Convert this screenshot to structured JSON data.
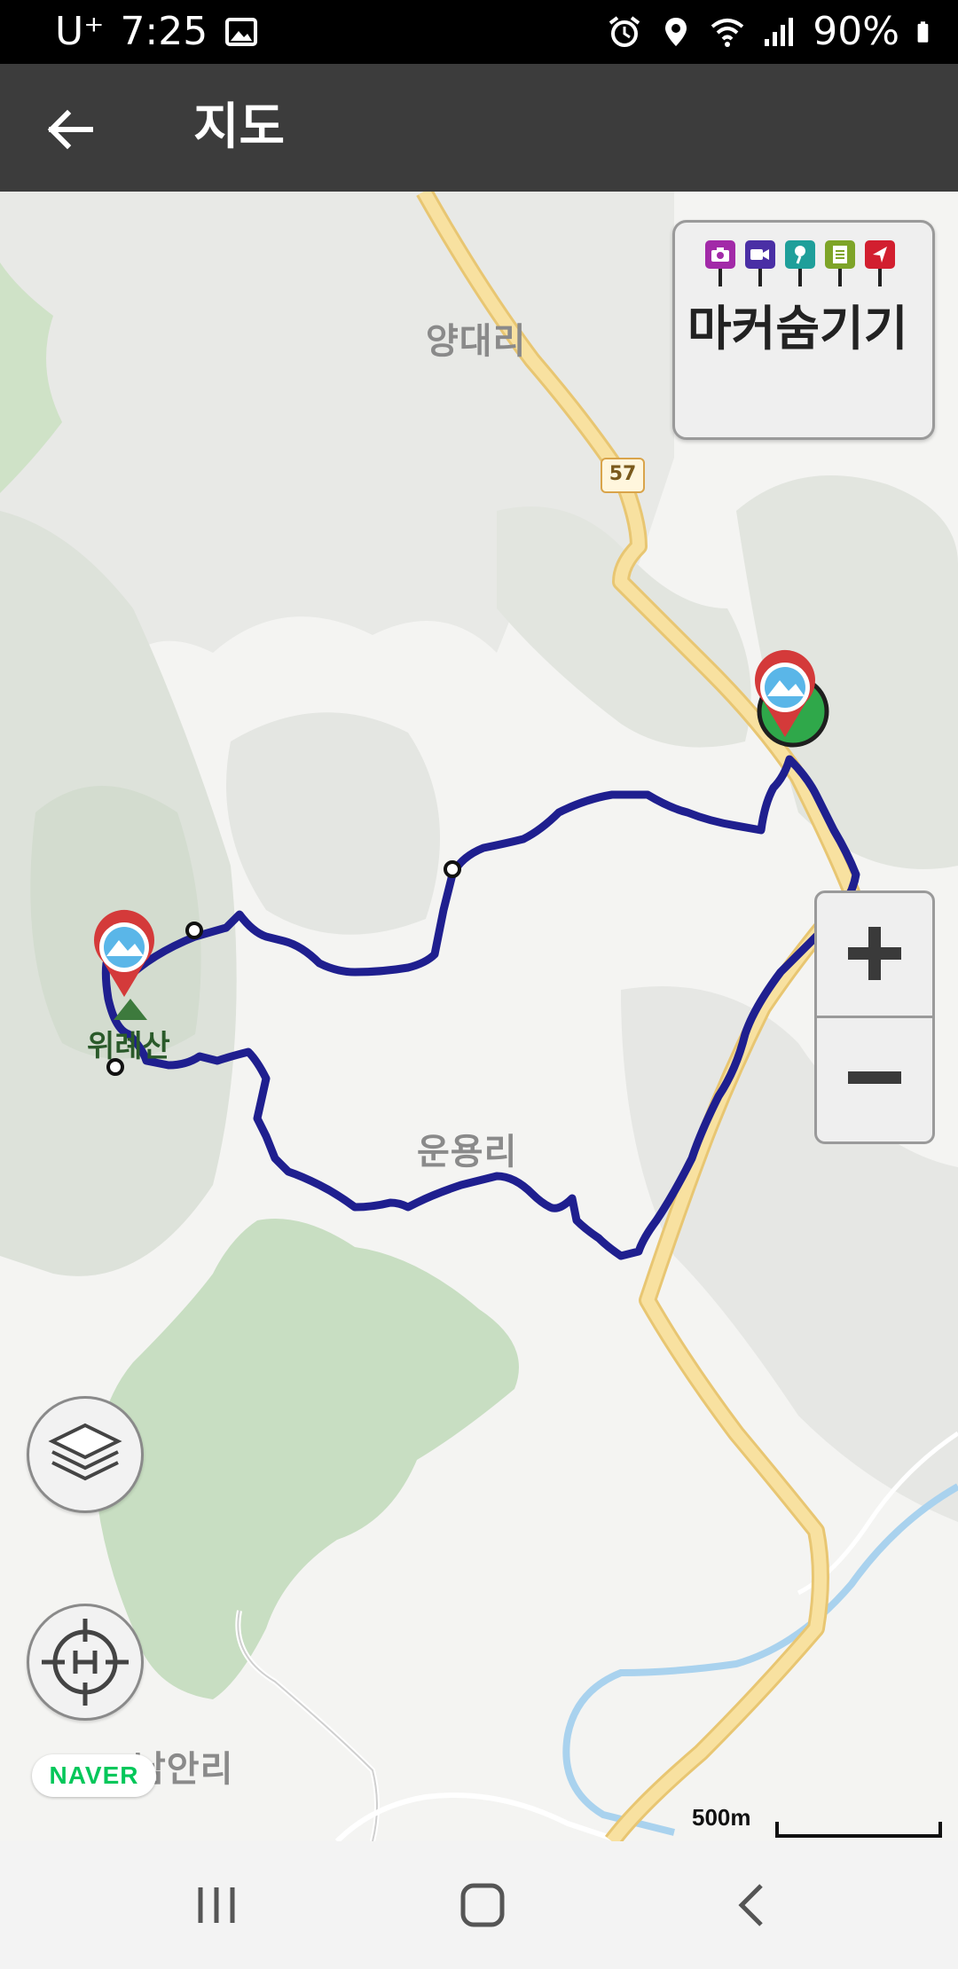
{
  "status_bar": {
    "carrier": "U⁺",
    "time": "7:25",
    "battery": "90%",
    "icons": [
      "gallery-icon",
      "alarm-icon",
      "location-icon",
      "wifi-icon",
      "signal-icon",
      "battery-icon"
    ]
  },
  "app_bar": {
    "title": "지도",
    "back_icon": "arrow-left-icon"
  },
  "map": {
    "places": {
      "yangdae": "양대리",
      "unyong": "운용리",
      "namap": "남안리",
      "mountain": "위례산"
    },
    "route_number": "57",
    "marker_panel": {
      "label": "마커숨기기",
      "flags": [
        {
          "icon": "camera-icon",
          "color": "#a22aa8"
        },
        {
          "icon": "video-icon",
          "color": "#4a2fa5"
        },
        {
          "icon": "mic-icon",
          "color": "#1f9f9a"
        },
        {
          "icon": "notepad-icon",
          "color": "#7ea428"
        },
        {
          "icon": "navigation-icon",
          "color": "#d21f2f"
        }
      ]
    },
    "zoom": {
      "in": "+",
      "out": "−"
    },
    "attribution": "NAVER",
    "scale_label": "500m",
    "colors": {
      "track": "#23229a",
      "road": "#f6d98c",
      "forest": "#c8dec2",
      "river": "#a9d2ee"
    }
  },
  "nav_bar": {
    "recent": "recent-apps-icon",
    "home": "home-icon",
    "back": "back-icon"
  }
}
